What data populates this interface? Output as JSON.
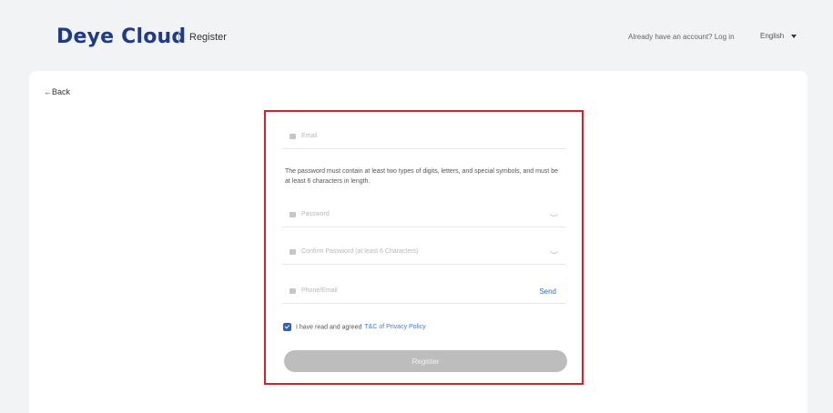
{
  "header": {
    "logo": "Deye Cloud",
    "page_name": "Register",
    "login_prompt": "Already have an account? Log in",
    "language": "English"
  },
  "nav": {
    "back_label": "Back"
  },
  "form": {
    "email_placeholder": "Email",
    "password_hint": "The password must contain at least two types of digits, letters, and special symbols, and must be at least 6 characters in length.",
    "password_placeholder": "Password",
    "confirm_placeholder": "Confirm Password (at least 6 Characters)",
    "phone_placeholder": "Phone/Email",
    "send_label": "Send",
    "agree_text": "I have read and agreed",
    "policy_link": "T&C of Privacy Policy",
    "agreed": true,
    "register_label": "Register"
  },
  "colors": {
    "brand": "#1f3a8a",
    "highlight_border": "#d9202c",
    "link": "#2f6bd1",
    "button_disabled": "#bdbdbd"
  }
}
